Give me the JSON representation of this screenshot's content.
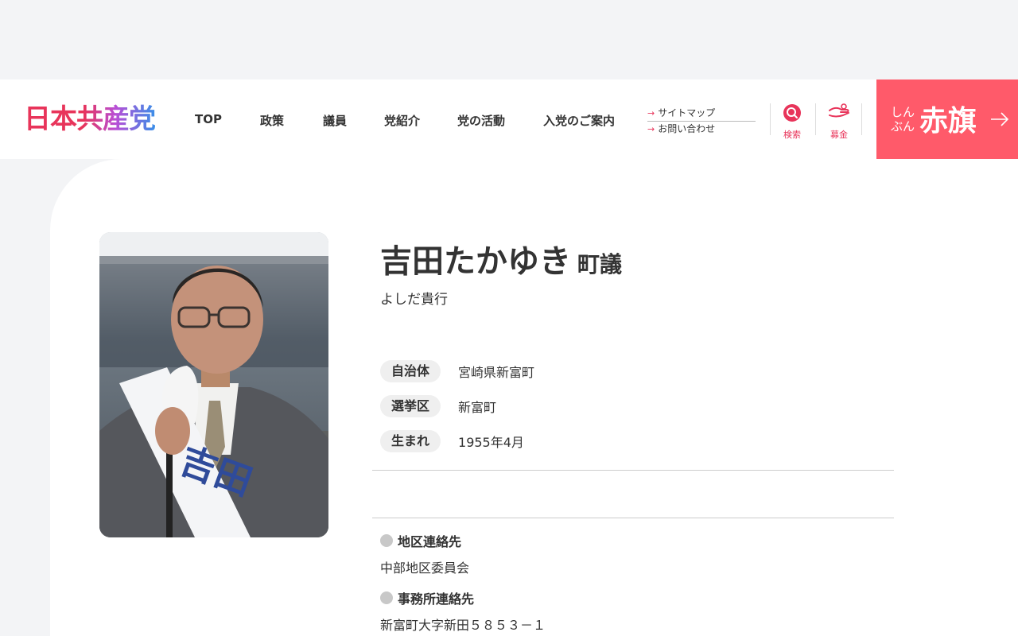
{
  "header": {
    "logo": "日本共産党",
    "nav": [
      "TOP",
      "政策",
      "議員",
      "党紹介",
      "党の活動",
      "入党のご案内"
    ],
    "sub_links": [
      "サイトマップ",
      "お問い合わせ"
    ],
    "search_label": "検索",
    "donate_label": "募金",
    "akahata_small_1": "しん",
    "akahata_small_2": "ぶん",
    "akahata_big": "赤旗"
  },
  "profile": {
    "name": "吉田たかゆき",
    "role": "町議",
    "kana": "よしだ貴行",
    "rows": [
      {
        "label": "自治体",
        "value": "宮崎県新富町"
      },
      {
        "label": "選挙区",
        "value": "新富町"
      },
      {
        "label": "生まれ",
        "value": "1955年4月"
      }
    ],
    "contact": [
      {
        "label": "地区連絡先",
        "value": "中部地区委員会"
      },
      {
        "label": "事務所連絡先",
        "value": "新富町大字新田５８５３－１"
      }
    ]
  },
  "colors": {
    "accent": "#e8345a",
    "akahata_bg": "#ff5a6a"
  }
}
